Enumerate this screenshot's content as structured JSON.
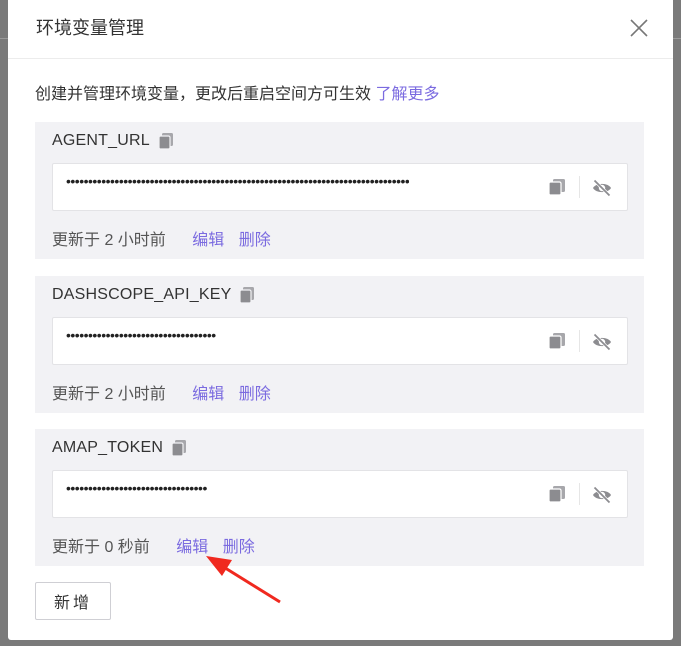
{
  "modal": {
    "title": "环境变量管理",
    "description": "创建并管理环境变量，更改后重启空间方可生效",
    "learn_more": "了解更多"
  },
  "variables": [
    {
      "name": "AGENT_URL",
      "masked_value": "••••••••••••••••••••••••••••••••••••••••••••••••••••••••••••••••••••••••••••••",
      "updated": "更新于 2 小时前",
      "edit_label": "编辑",
      "delete_label": "删除"
    },
    {
      "name": "DASHSCOPE_API_KEY",
      "masked_value": "••••••••••••••••••••••••••••••••••",
      "updated": "更新于 2 小时前",
      "edit_label": "编辑",
      "delete_label": "删除"
    },
    {
      "name": "AMAP_TOKEN",
      "masked_value": "••••••••••••••••••••••••••••••••",
      "updated": "更新于 0 秒前",
      "edit_label": "编辑",
      "delete_label": "删除"
    }
  ],
  "add_button_label": "新增",
  "colors": {
    "accent": "#7b6be0",
    "card_bg": "#f2f2f5",
    "annotation_arrow": "#f0291f"
  },
  "icons": {
    "close": "close-icon",
    "copy": "copy-icon",
    "visibility": "eye-off-icon"
  }
}
